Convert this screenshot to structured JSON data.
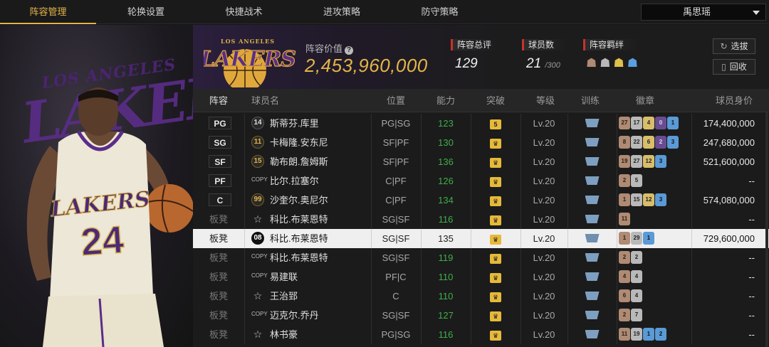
{
  "nav": {
    "tabs": [
      {
        "label": "阵容管理",
        "active": true
      },
      {
        "label": "轮换设置",
        "active": false
      },
      {
        "label": "快捷战术",
        "active": false
      },
      {
        "label": "进攻策略",
        "active": false
      },
      {
        "label": "防守策略",
        "active": false
      }
    ],
    "user": "禹思瑶"
  },
  "hero": {
    "logo_big": "LAKERS",
    "logo_small": "LOS ANGELES",
    "jersey_team": "LAKERS",
    "jersey_number": "24"
  },
  "team": {
    "logo_text": "LAKERS",
    "logo_sub": "LOS ANGELES",
    "value_label": "阵容价值",
    "value": "2,453,960,000",
    "rating_label": "阵容总评",
    "rating": "129",
    "players_label": "球员数",
    "players": "21",
    "players_max": "/300",
    "bond_label": "阵容羁绊",
    "select_btn": "选拔",
    "recycle_btn": "回收"
  },
  "table": {
    "headers": [
      "阵容",
      "球员名",
      "位置",
      "能力",
      "突破",
      "等级",
      "训练",
      "徽章",
      "球员身价"
    ],
    "rows": [
      {
        "slot": "PG",
        "starter": true,
        "jersey": "14",
        "jtype": "normal",
        "name": "斯蒂芬.库里",
        "pos": "PG|SG",
        "ability": "123",
        "brk": "5",
        "level": "Lv.20",
        "badges": [
          [
            "27",
            "bronze"
          ],
          [
            "17",
            "silver"
          ],
          [
            "4",
            "gold"
          ],
          [
            "0",
            "purple"
          ],
          [
            "1",
            "blue"
          ]
        ],
        "price": "174,400,000"
      },
      {
        "slot": "SG",
        "starter": true,
        "jersey": "11",
        "jtype": "gold",
        "name": "卡梅隆.安东尼",
        "pos": "SF|PF",
        "ability": "130",
        "brk": "♛",
        "level": "Lv.20",
        "badges": [
          [
            "8",
            "bronze"
          ],
          [
            "22",
            "silver"
          ],
          [
            "6",
            "gold"
          ],
          [
            "2",
            "purple"
          ],
          [
            "3",
            "blue"
          ]
        ],
        "price": "247,680,000"
      },
      {
        "slot": "SF",
        "starter": true,
        "jersey": "15",
        "jtype": "gold",
        "name": "勒布朗.詹姆斯",
        "pos": "SF|PF",
        "ability": "136",
        "brk": "♛",
        "level": "Lv.20",
        "badges": [
          [
            "19",
            "bronze"
          ],
          [
            "27",
            "silver"
          ],
          [
            "12",
            "gold"
          ],
          [
            "3",
            "blue"
          ]
        ],
        "price": "521,600,000"
      },
      {
        "slot": "PF",
        "starter": true,
        "jersey": "COPY",
        "jtype": "copy",
        "name": "比尔.拉塞尔",
        "pos": "C|PF",
        "ability": "126",
        "brk": "♛",
        "level": "Lv.20",
        "badges": [
          [
            "2",
            "bronze"
          ],
          [
            "5",
            "silver"
          ]
        ],
        "price": "--"
      },
      {
        "slot": "C",
        "starter": true,
        "jersey": "99",
        "jtype": "gold",
        "name": "沙奎尔.奥尼尔",
        "pos": "C|PF",
        "ability": "134",
        "brk": "♛",
        "level": "Lv.20",
        "badges": [
          [
            "1",
            "bronze"
          ],
          [
            "15",
            "silver"
          ],
          [
            "12",
            "gold"
          ],
          [
            "3",
            "blue"
          ]
        ],
        "price": "574,080,000"
      },
      {
        "slot": "板凳",
        "starter": false,
        "jersey": "☆",
        "jtype": "star",
        "name": "科比.布莱恩特",
        "pos": "SG|SF",
        "ability": "116",
        "brk": "♛",
        "level": "Lv.20",
        "badges": [
          [
            "11",
            "bronze"
          ]
        ],
        "price": "--"
      },
      {
        "slot": "板凳",
        "starter": false,
        "highlight": true,
        "jersey": "08",
        "jtype": "normal",
        "name": "科比.布莱恩特",
        "pos": "SG|SF",
        "ability": "135",
        "brk": "♛",
        "level": "Lv.20",
        "badges": [
          [
            "1",
            "bronze"
          ],
          [
            "29",
            "silver"
          ],
          [
            "1",
            "blue"
          ]
        ],
        "price": "729,600,000"
      },
      {
        "slot": "板凳",
        "starter": false,
        "jersey": "COPY",
        "jtype": "copy",
        "name": "科比.布莱恩特",
        "pos": "SG|SF",
        "ability": "119",
        "brk": "♛",
        "level": "Lv.20",
        "badges": [
          [
            "2",
            "bronze"
          ],
          [
            "2",
            "silver"
          ]
        ],
        "price": "--"
      },
      {
        "slot": "板凳",
        "starter": false,
        "jersey": "COPY",
        "jtype": "copy",
        "name": "易建联",
        "pos": "PF|C",
        "ability": "110",
        "brk": "♛",
        "level": "Lv.20",
        "badges": [
          [
            "4",
            "bronze"
          ],
          [
            "4",
            "silver"
          ]
        ],
        "price": "--"
      },
      {
        "slot": "板凳",
        "starter": false,
        "jersey": "☆",
        "jtype": "star",
        "name": "王治郅",
        "pos": "C",
        "ability": "110",
        "brk": "♛",
        "level": "Lv.20",
        "badges": [
          [
            "6",
            "bronze"
          ],
          [
            "4",
            "silver"
          ]
        ],
        "price": "--"
      },
      {
        "slot": "板凳",
        "starter": false,
        "jersey": "COPY",
        "jtype": "copy",
        "name": "迈克尔.乔丹",
        "pos": "SG|SF",
        "ability": "127",
        "brk": "♛",
        "level": "Lv.20",
        "badges": [
          [
            "2",
            "bronze"
          ],
          [
            "7",
            "silver"
          ]
        ],
        "price": "--"
      },
      {
        "slot": "板凳",
        "starter": false,
        "jersey": "☆",
        "jtype": "star",
        "name": "林书豪",
        "pos": "PG|SG",
        "ability": "116",
        "brk": "♛",
        "level": "Lv.20",
        "badges": [
          [
            "11",
            "bronze"
          ],
          [
            "19",
            "silver"
          ],
          [
            "1",
            "blue"
          ],
          [
            "2",
            "blue"
          ]
        ],
        "price": "--"
      }
    ]
  }
}
